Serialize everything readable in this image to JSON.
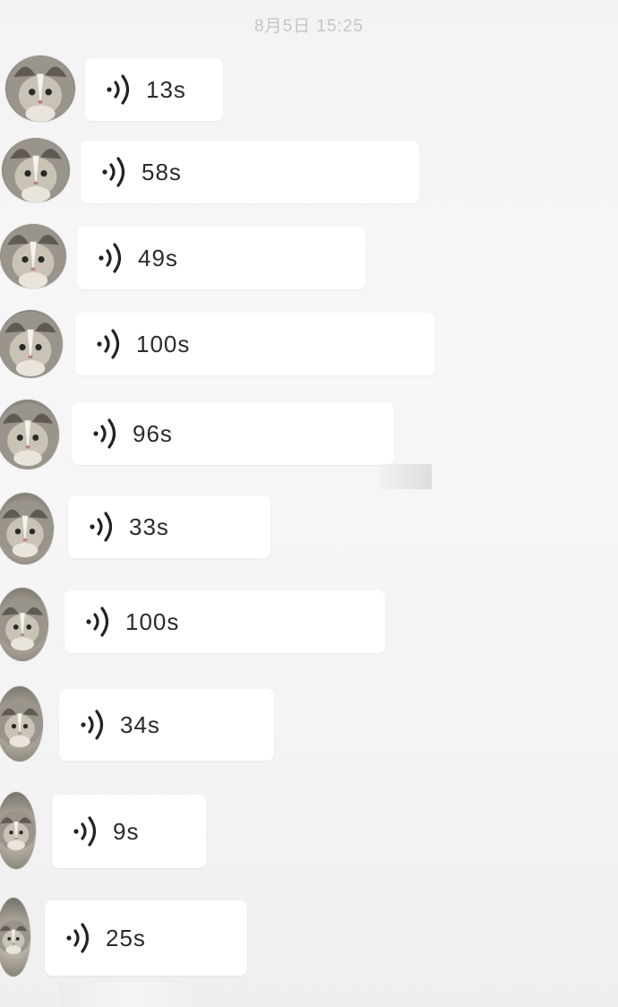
{
  "header": {
    "timestamp": "8月5日 15:25"
  },
  "colors": {
    "background": "#f4f4f4",
    "bubble": "#ffffff",
    "timestamp": "#c6c6c6",
    "text": "#2b2b2b"
  },
  "messages": [
    {
      "icon": "voice-wave-icon",
      "duration": "13s"
    },
    {
      "icon": "voice-wave-icon",
      "duration": "58s"
    },
    {
      "icon": "voice-wave-icon",
      "duration": "49s"
    },
    {
      "icon": "voice-wave-icon",
      "duration": "100s"
    },
    {
      "icon": "voice-wave-icon",
      "duration": "96s"
    },
    {
      "icon": "voice-wave-icon",
      "duration": "33s"
    },
    {
      "icon": "voice-wave-icon",
      "duration": "100s"
    },
    {
      "icon": "voice-wave-icon",
      "duration": "34s"
    },
    {
      "icon": "voice-wave-icon",
      "duration": "9s"
    },
    {
      "icon": "voice-wave-icon",
      "duration": "25s"
    }
  ]
}
